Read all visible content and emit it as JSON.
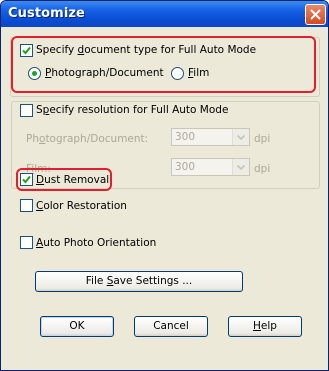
{
  "window": {
    "title": "Customize"
  },
  "doc_type": {
    "checkbox_pre": "Specify ",
    "checkbox_mn": "d",
    "checkbox_post": "ocument type for Full Auto Mode",
    "checked": true,
    "photo_mn": "P",
    "photo_post": "hotograph/Document",
    "film_mn": "F",
    "film_post": "ilm",
    "selected": "Photograph/Document"
  },
  "resolution": {
    "checkbox_pre": "S",
    "checkbox_mn": "p",
    "checkbox_post": "ecify resolution for Full Auto Mode",
    "checked": false,
    "photo_pre": "Ph",
    "photo_mn": "o",
    "photo_post": "tograph/Document:",
    "photo_value": "300",
    "film_pre": "F",
    "film_mn": "i",
    "film_post": "lm:",
    "film_value": "300",
    "unit": "dpi"
  },
  "dust": {
    "mn": "D",
    "post": "ust Removal",
    "checked": true
  },
  "color": {
    "mn": "C",
    "post": "olor Restoration",
    "checked": false
  },
  "orient": {
    "mn": "A",
    "post": "uto Photo Orientation",
    "checked": false
  },
  "buttons": {
    "file_save_pre": "File ",
    "file_save_mn": "S",
    "file_save_post": "ave Settings ...",
    "ok": "OK",
    "cancel": "Cancel",
    "help_mn": "H",
    "help_post": "elp"
  },
  "colors": {
    "highlight": "#e0202e",
    "titlebar": "#0a4fd4",
    "dialog_bg": "#ece9d8"
  }
}
